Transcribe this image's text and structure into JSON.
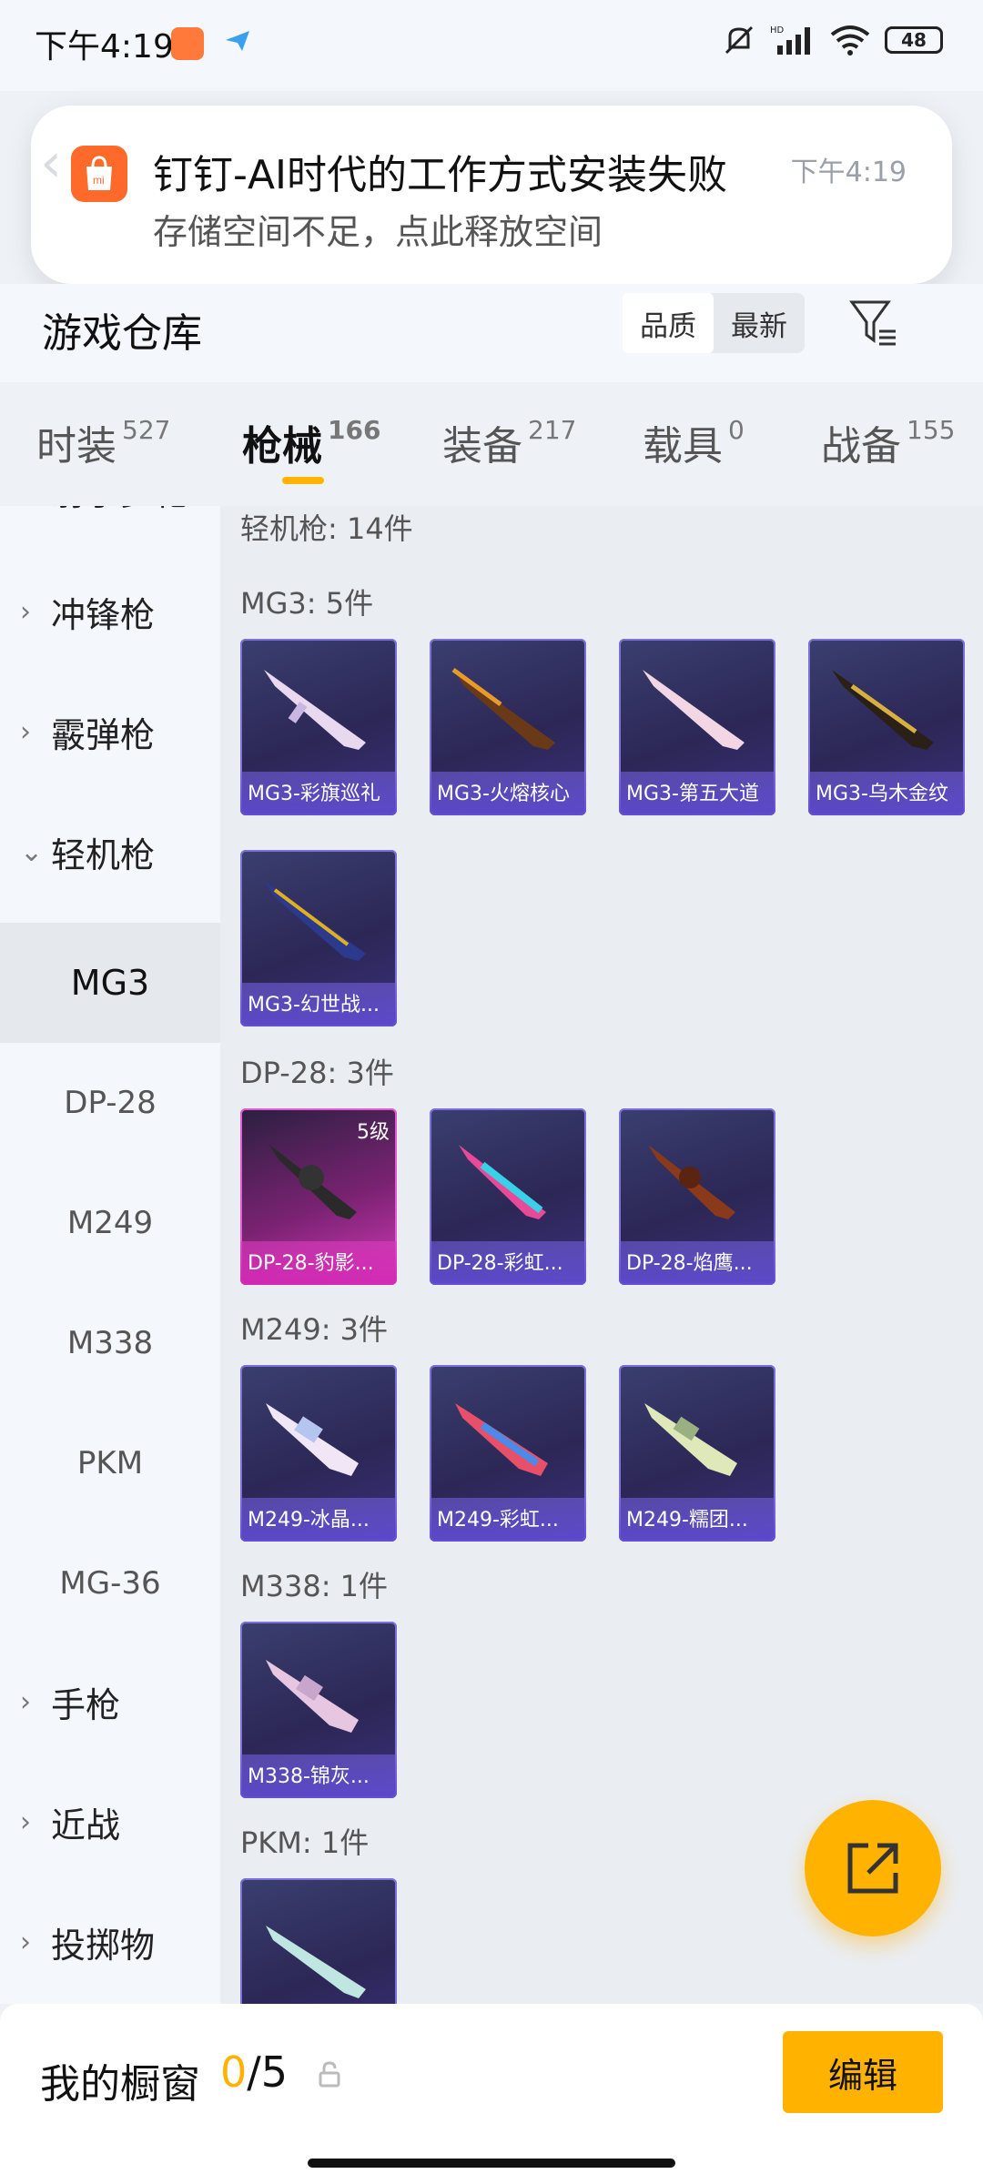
{
  "status_bar": {
    "time": "下午4:19",
    "battery": "48",
    "icons": [
      "mute-vibrate-icon",
      "hd-signal-icon",
      "wifi-icon",
      "battery-icon"
    ]
  },
  "notification": {
    "title": "钉钉-AI时代的工作方式安装失败",
    "time": "下午4:19",
    "body": "存储空间不足，点此释放空间"
  },
  "header": {
    "title": "游戏仓库",
    "sort_options": [
      "品质",
      "最新"
    ],
    "sort_selected": "品质"
  },
  "tabs": [
    {
      "label": "时装",
      "count": "527"
    },
    {
      "label": "枪械",
      "count": "166",
      "active": true
    },
    {
      "label": "装备",
      "count": "217"
    },
    {
      "label": "载具",
      "count": "0"
    },
    {
      "label": "战备",
      "count": "155"
    }
  ],
  "sidebar": {
    "partial_top": "射手步枪",
    "categories": [
      "冲锋枪",
      "霰弹枪",
      "轻机枪"
    ],
    "subitems": [
      "MG3",
      "DP-28",
      "M249",
      "M338",
      "PKM",
      "MG-36"
    ],
    "bottom_categories": [
      "手枪",
      "近战",
      "投掷物"
    ]
  },
  "content": {
    "group_header": "轻机枪: 14件",
    "sections": [
      {
        "title": "MG3: 5件",
        "items": [
          "MG3-彩旗巡礼",
          "MG3-火熔核心",
          "MG3-第五大道",
          "MG3-乌木金纹",
          "MG3-幻世战..."
        ]
      },
      {
        "title": "DP-28: 3件",
        "items": [
          "DP-28-豹影...",
          "DP-28-彩虹...",
          "DP-28-焰鹰..."
        ],
        "level_badge": "5级"
      },
      {
        "title": "M249: 3件",
        "items": [
          "M249-冰晶...",
          "M249-彩虹...",
          "M249-糯团..."
        ]
      },
      {
        "title": "M338: 1件",
        "items": [
          "M338-锦灰..."
        ]
      },
      {
        "title": "PKM: 1件",
        "items": [
          ""
        ]
      }
    ]
  },
  "bottom_bar": {
    "label": "我的橱窗",
    "count_current": "0",
    "count_total": "/5",
    "edit_label": "编辑"
  },
  "colors": {
    "accent": "#ffb300",
    "card_purple": "#2c2756",
    "card_pink": "#d33ab8"
  }
}
